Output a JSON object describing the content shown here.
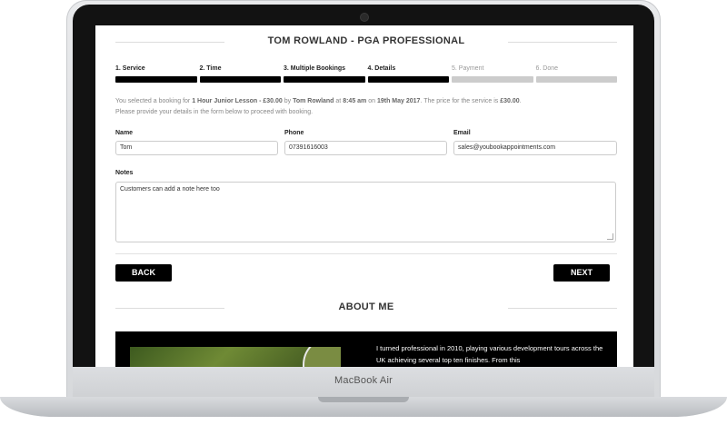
{
  "device": {
    "brand": "MacBook Air"
  },
  "page": {
    "title": "TOM ROWLAND - PGA PROFESSIONAL",
    "steps": [
      {
        "label": "1. Service",
        "state": "done"
      },
      {
        "label": "2. Time",
        "state": "done"
      },
      {
        "label": "3. Multiple Bookings",
        "state": "done"
      },
      {
        "label": "4. Details",
        "state": "current"
      },
      {
        "label": "5. Payment",
        "state": "todo"
      },
      {
        "label": "6. Done",
        "state": "todo"
      }
    ],
    "info": {
      "pre": "You selected a booking for ",
      "service": "1 Hour Junior Lesson - £30.00",
      "by": " by ",
      "pro": "Tom Rowland",
      "at": " at ",
      "time": "8:45 am",
      "on": " on ",
      "date": "19th May 2017",
      "price_pre": ". The price for the service is ",
      "price": "£30.00",
      "end": ".",
      "line2": "Please provide your details in the form below to proceed with booking."
    },
    "form": {
      "name_label": "Name",
      "name_value": "Tom",
      "phone_label": "Phone",
      "phone_value": "07391616003",
      "email_label": "Email",
      "email_value": "sales@youbookappointments.com",
      "notes_label": "Notes",
      "notes_value": "Customers can add a note here too"
    },
    "buttons": {
      "back": "BACK",
      "next": "NEXT"
    },
    "about": {
      "title": "ABOUT ME",
      "text": "I turned professional in 2010, playing various development tours across the UK achieving several top ten finishes. From this"
    }
  },
  "colors": {
    "accent": "#000000",
    "inactive_step": "#cccccc",
    "muted_text": "#888888"
  }
}
